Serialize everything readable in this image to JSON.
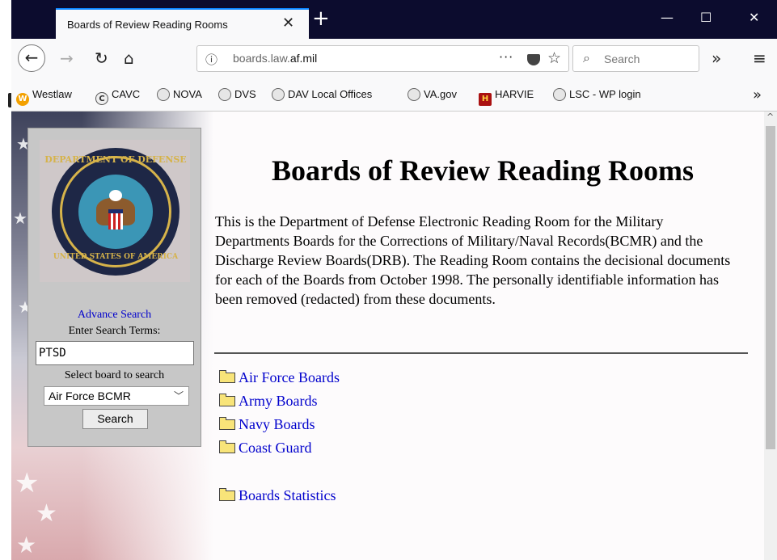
{
  "browser": {
    "tab_title": "Boards of Review Reading Rooms",
    "tab_close": "✕",
    "new_tab": "+",
    "window_controls": {
      "minimize": "—",
      "maximize": "☐",
      "close": "✕"
    },
    "nav": {
      "back": "←",
      "forward": "→",
      "reload": "↻",
      "home": "⌂",
      "overflow": "»",
      "menu": "≡"
    },
    "url_prefix": "boards.law.",
    "url_domain": "af.mil",
    "url_info_icon": "ⓘ",
    "url_actions": {
      "more": "···",
      "bookmark_star": "☆"
    },
    "search_placeholder": "Search",
    "search_icon": "🔍"
  },
  "bookmarks": [
    {
      "label": "Westlaw",
      "icon": "W"
    },
    {
      "label": "CAVC",
      "icon": "C"
    },
    {
      "label": "NOVA",
      "icon": "g"
    },
    {
      "label": "DVS",
      "icon": "g"
    },
    {
      "label": "DAV Local Offices",
      "icon": "g"
    },
    {
      "label": "VA.gov",
      "icon": "g"
    },
    {
      "label": "HARVIE",
      "icon": "H"
    },
    {
      "label": "LSC - WP login",
      "icon": "g"
    }
  ],
  "bookmarks_more": "»",
  "sidebar": {
    "seal_top": "DEPARTMENT OF DEFENSE",
    "seal_bottom": "UNITED STATES OF AMERICA",
    "advance_search": "Advance Search",
    "enter_terms": "Enter Search Terms:",
    "search_value": "PTSD",
    "select_label": "Select board to search",
    "select_value": "Air Force BCMR",
    "search_button": "Search"
  },
  "main": {
    "title": "Boards of Review Reading Rooms",
    "intro": "This is the Department of Defense Electronic Reading Room for the Military Departments Boards for the Corrections of Military/Naval Records(BCMR) and the Discharge Review Boards(DRB). The Reading Room contains the decisional documents for each of the Boards from October 1998. The personally identifiable information has been removed (redacted) from these documents.",
    "links": [
      "Air Force Boards",
      "Army Boards",
      "Navy Boards",
      "Coast Guard"
    ],
    "stats_link": "Boards Statistics"
  },
  "colors": {
    "link": "#0000cc",
    "titlebar": "#0c0c2e",
    "tab_accent": "#0a84ff",
    "panel": "#c7c7c7"
  }
}
